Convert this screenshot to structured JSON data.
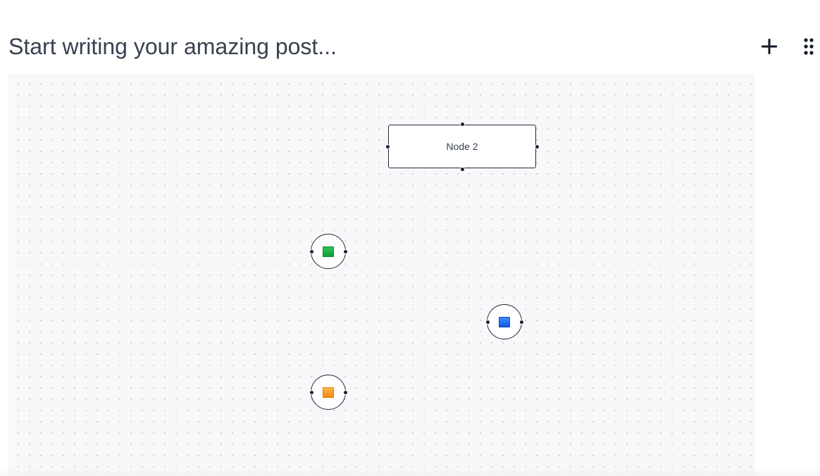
{
  "editor": {
    "title_placeholder": "Start writing your amazing post..."
  },
  "toolbar": {
    "add_icon": "plus-icon",
    "drag_icon": "drag-handle-icon"
  },
  "flow": {
    "nodes": [
      {
        "id": "node-2",
        "type": "rectangle",
        "label": "Node 2"
      },
      {
        "id": "circle-green",
        "type": "circle",
        "icon": "green-square-icon",
        "color": "#16a34a"
      },
      {
        "id": "circle-blue",
        "type": "circle",
        "icon": "blue-square-icon",
        "color": "#2563eb"
      },
      {
        "id": "circle-orange",
        "type": "circle",
        "icon": "orange-square-icon",
        "color": "#f59e0b"
      }
    ]
  }
}
